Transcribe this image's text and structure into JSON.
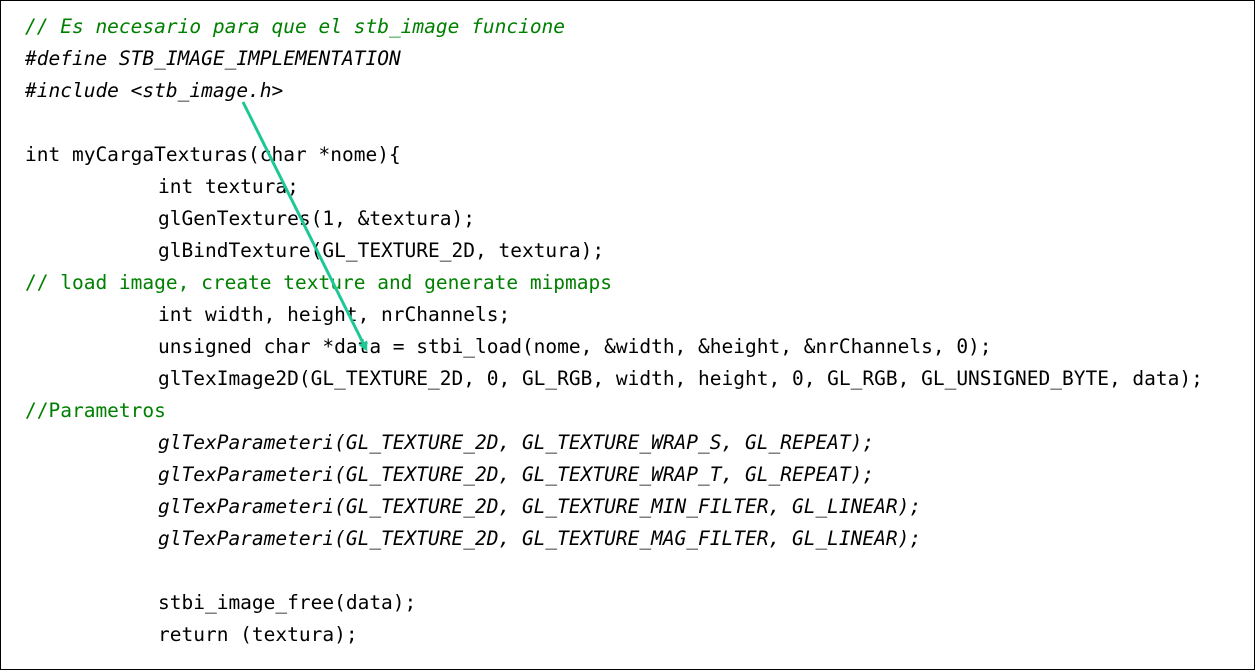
{
  "code_lines": [
    "// Es necesario para que el stb_image funcione",
    "#define STB_IMAGE_IMPLEMENTATION",
    "#include <stb_image.h>",
    "",
    "int myCargaTexturas(char *nome){",
    "int textura;",
    "glGenTextures(1, &textura);",
    "glBindTexture(GL_TEXTURE_2D, textura);",
    "// load image, create texture and generate mipmaps",
    "int width, height, nrChannels;",
    "unsigned char *data = stbi_load(nome, &width, &height, &nrChannels, 0);",
    "glTexImage2D(GL_TEXTURE_2D, 0, GL_RGB, width, height, 0, GL_RGB, GL_UNSIGNED_BYTE, data);",
    "//Parametros",
    "glTexParameteri(GL_TEXTURE_2D, GL_TEXTURE_WRAP_S, GL_REPEAT);",
    "glTexParameteri(GL_TEXTURE_2D, GL_TEXTURE_WRAP_T, GL_REPEAT);",
    "glTexParameteri(GL_TEXTURE_2D, GL_TEXTURE_MIN_FILTER, GL_LINEAR);",
    "glTexParameteri(GL_TEXTURE_2D, GL_TEXTURE_MAG_FILTER, GL_LINEAR);",
    "",
    "stbi_image_free(data);",
    "return (textura);"
  ],
  "colors": {
    "comment": "#008000",
    "code": "#000000",
    "arrow": "#1ec896",
    "border": "#000000",
    "background": "#ffffff"
  },
  "annotation": {
    "type": "arrow-icon",
    "meaning": "links include of stb_image.h to stbi_load usage"
  }
}
